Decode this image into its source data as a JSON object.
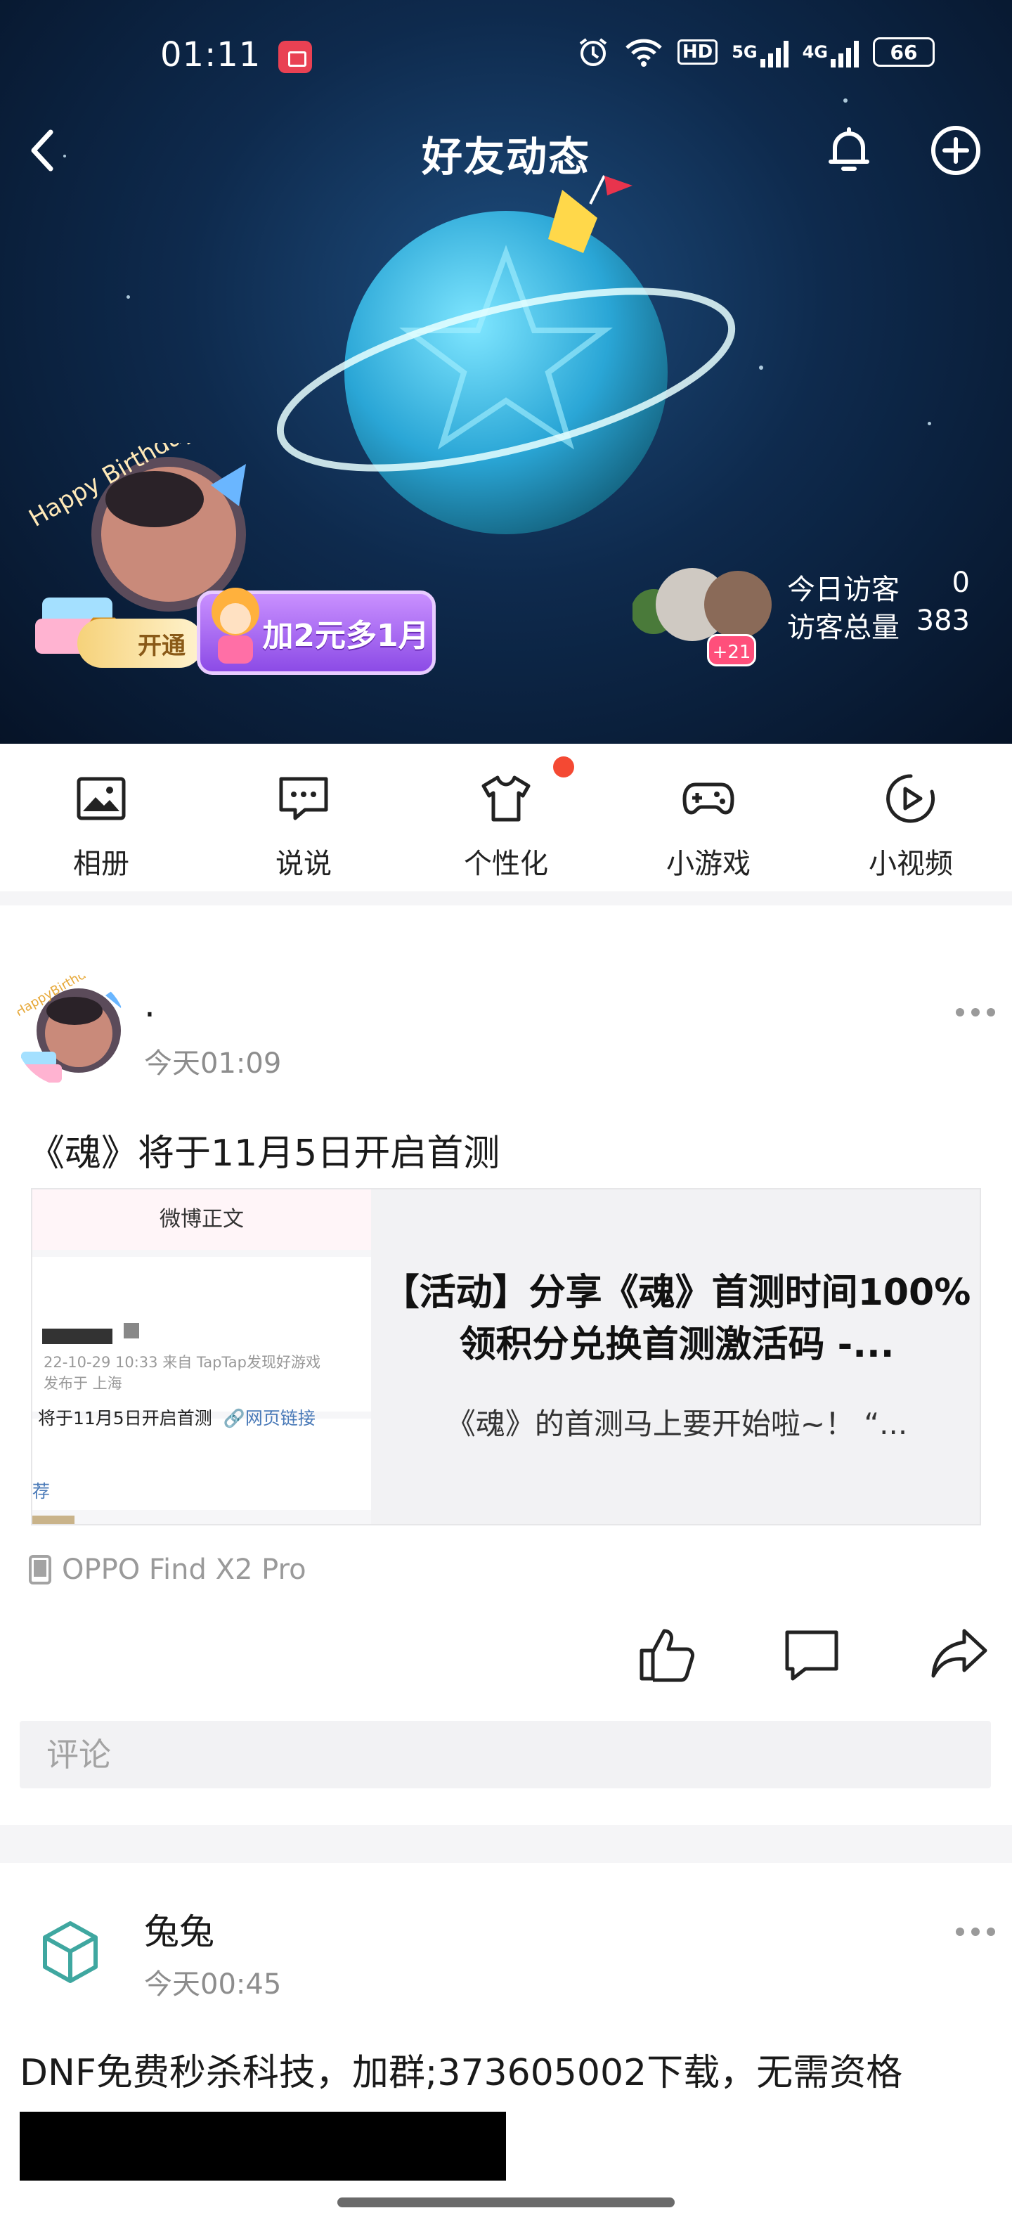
{
  "status_bar": {
    "time": "01:11",
    "hd": "HD",
    "net1": "5G",
    "net2": "4G",
    "battery": "66"
  },
  "header": {
    "title": "好友动态"
  },
  "profile": {
    "vip_badge": "开通",
    "promo": "加2元多1月",
    "visitor_more": "+21",
    "today_visitors_label": "今日访客",
    "today_visitors_value": "0",
    "total_visitors_label": "访客总量",
    "total_visitors_value": "383"
  },
  "quick_nav": [
    {
      "label": "相册",
      "icon": "photo-icon"
    },
    {
      "label": "说说",
      "icon": "chat-bubble-icon"
    },
    {
      "label": "个性化",
      "icon": "tshirt-icon"
    },
    {
      "label": "小游戏",
      "icon": "gamepad-icon"
    },
    {
      "label": "小视频",
      "icon": "video-play-icon"
    }
  ],
  "posts": [
    {
      "name": ".",
      "time": "今天01:09",
      "text": "《魂》将于11月5日开启首测",
      "link": {
        "thumb_title": "微博正文",
        "thumb_meta1": "22-10-29 10:33  来自 TapTap发现好游戏",
        "thumb_meta2": "发布于 上海",
        "thumb_line": "将于11月5日开启首测",
        "thumb_link": "网页链接",
        "thumb_more": "荐",
        "title": "【活动】分享《魂》首测时间100%领积分兑换首测激活码 -...",
        "desc": "《魂》的首测马上要开始啦~！ “..."
      },
      "device": "OPPO Find X2 Pro",
      "comment_placeholder": "评论"
    },
    {
      "name": "兔兔",
      "time": "今天00:45",
      "text": "DNF免费秒杀科技，加群;373605002下载，无需资格"
    }
  ],
  "colors": {
    "accent_red": "#f44933",
    "promo_purple": "#8c4be6",
    "link_blue": "#4a7ab8"
  }
}
